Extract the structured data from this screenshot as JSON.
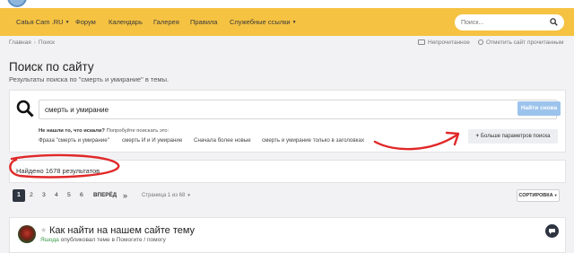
{
  "nav": {
    "items": [
      {
        "label": "Catья Cam .RU",
        "has_caret": true
      },
      {
        "label": "Форум",
        "has_caret": false
      },
      {
        "label": "Календарь",
        "has_caret": false
      },
      {
        "label": "Галерея",
        "has_caret": false
      },
      {
        "label": "Правила",
        "has_caret": false
      },
      {
        "label": "Служебные ссылки",
        "has_caret": true
      }
    ],
    "search_placeholder": "Поиск...",
    "bar_color": "#f5c242"
  },
  "breadcrumb": {
    "items": [
      "Главная",
      "Поиск"
    ]
  },
  "top_actions": {
    "unread": "Непрочитанное",
    "mark_read": "Отметить сайт прочитанным"
  },
  "header": {
    "title": "Поиск по сайту",
    "subtitle": "Результаты поиска по \"смерть и умирание\" в темы."
  },
  "search_panel": {
    "query": "смерть и умирание",
    "search_again": "Найти снова",
    "not_found_bold": "Не нашли то, что искали?",
    "not_found_rest": " Попробуйте поискать это:",
    "suggestions": [
      "Фраза \"смерть и умирание\"",
      "смерть И и И умирание",
      "Сначала более новые",
      "смерть и умирание только в заголовках"
    ],
    "more_params": "Больше параметров поиска"
  },
  "results": {
    "count_text": "Найдено 1678 результатов"
  },
  "pagination": {
    "current": "1",
    "pages": [
      "2",
      "3",
      "4",
      "5",
      "6"
    ],
    "next": "ВПЕРЁД",
    "last": "»",
    "page_of": "Страница 1 из 68",
    "sort": "СОРТИРОВКА"
  },
  "result_item": {
    "title": "Как найти на нашем сайте тему",
    "user": "Яшода",
    "meta": " опубликовал теме в Помогите / помогу"
  },
  "colors": {
    "accent": "#f5c242",
    "button_blue": "#9cc3ec",
    "annotation_red": "#e02828",
    "pager_active": "#2e3440"
  }
}
